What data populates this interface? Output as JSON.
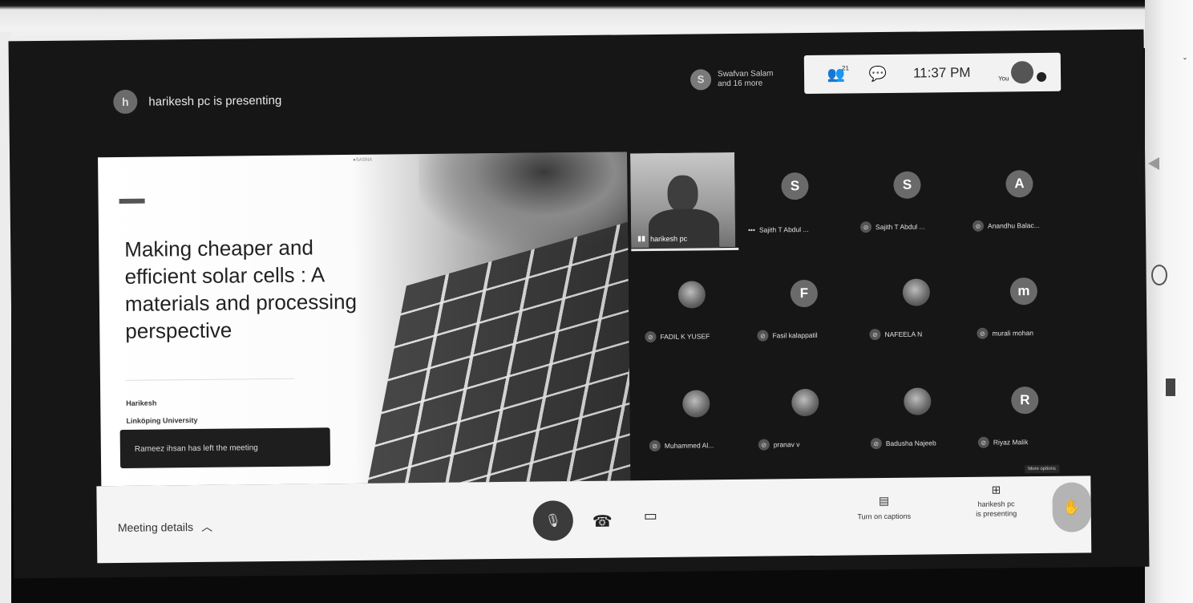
{
  "presenter_banner": {
    "avatar_initial": "h",
    "text": "harikesh pc is presenting"
  },
  "joined": {
    "avatar_initial": "S",
    "line1": "Swafvan Salam",
    "line2": "and 16 more"
  },
  "top_pill": {
    "people_count": "21",
    "clock": "11:37 PM",
    "you_label": "You",
    "mic_badge": "0"
  },
  "slide": {
    "top_mark": "●SASNA",
    "title": "Making cheaper and efficient solar cells : A materials and processing perspective",
    "author": "Harikesh",
    "affiliation": "Linköping University"
  },
  "toast": "Rameez ihsan has left the meeting",
  "self_tile": {
    "name": "harikesh pc"
  },
  "participants": [
    {
      "initial": "S",
      "name": "Sajith T Abdul ..."
    },
    {
      "initial": "S",
      "name": "Sajith T Abdul ..."
    },
    {
      "initial": "A",
      "name": "Anandhu Balac..."
    },
    {
      "initial": "",
      "name": "FADIL K YUSEF"
    },
    {
      "initial": "F",
      "name": "Fasil kalappatil"
    },
    {
      "initial": "",
      "name": "NAFEELA N"
    },
    {
      "initial": "m",
      "name": "murali mohan"
    },
    {
      "initial": "",
      "name": "Muhammed Al..."
    },
    {
      "initial": "",
      "name": "pranav v"
    },
    {
      "initial": "",
      "name": "Badusha Najeeb"
    },
    {
      "initial": "R",
      "name": "Riyaz Malik"
    }
  ],
  "more_options_tip": "More options",
  "bottom_bar": {
    "meeting_details": "Meeting details",
    "captions_label": "Turn on captions",
    "present_label_1": "harikesh pc",
    "present_label_2": "is presenting"
  },
  "icons": {
    "mic": "mic-off-icon",
    "hangup": "hangup-icon",
    "camera": "camera-icon",
    "captions": "captions-icon",
    "present": "present-icon",
    "raise": "raise-hand-icon",
    "people": "people-icon",
    "chat": "chat-icon"
  },
  "colors": {
    "bar_bg": "#f4f4f4",
    "screen_bg": "#161616",
    "tile_avatar": "#6a6a6a"
  }
}
